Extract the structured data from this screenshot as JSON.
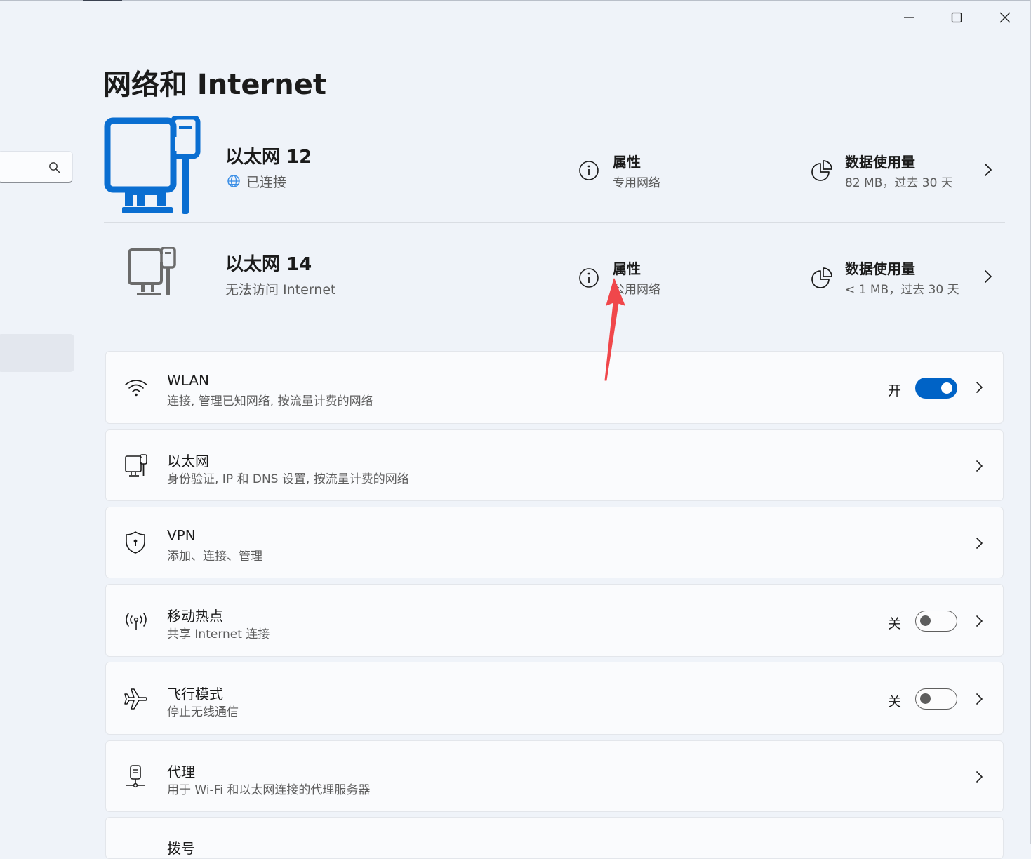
{
  "window": {
    "controls": [
      "minimize-icon",
      "maximize-icon",
      "close-icon"
    ]
  },
  "search": {
    "icon": "search-icon"
  },
  "page": {
    "title": "网络和 Internet"
  },
  "adapters": [
    {
      "name": "以太网 12",
      "status": "已连接",
      "status_icon": "globe-icon",
      "properties_label": "属性",
      "network_type": "专用网络",
      "data_usage_label": "数据使用量",
      "data_usage_value": "82 MB，过去 30 天",
      "icon_color": "#0a6ed1"
    },
    {
      "name": "以太网 14",
      "status": "无法访问 Internet",
      "properties_label": "属性",
      "network_type": "公用网络",
      "data_usage_label": "数据使用量",
      "data_usage_value": "< 1 MB，过去 30 天",
      "icon_color": "#6b6b6b"
    }
  ],
  "settings": [
    {
      "title": "WLAN",
      "subtitle": "连接, 管理已知网络, 按流量计费的网络",
      "icon": "wifi-icon",
      "state_label": "开",
      "toggle_on": true
    },
    {
      "title": "以太网",
      "subtitle": "身份验证, IP 和 DNS 设置, 按流量计费的网络",
      "icon": "ethernet-icon"
    },
    {
      "title": "VPN",
      "subtitle": "添加、连接、管理",
      "icon": "shield-icon"
    },
    {
      "title": "移动热点",
      "subtitle": "共享 Internet 连接",
      "icon": "hotspot-icon",
      "state_label": "关",
      "toggle_on": false
    },
    {
      "title": "飞行模式",
      "subtitle": "停止无线通信",
      "icon": "airplane-icon",
      "state_label": "关",
      "toggle_on": false
    },
    {
      "title": "代理",
      "subtitle": "用于 Wi-Fi 和以太网连接的代理服务器",
      "icon": "proxy-icon"
    },
    {
      "title": "拨号"
    }
  ],
  "colors": {
    "accent": "#0063c6",
    "annotation_arrow": "#f0474b"
  }
}
